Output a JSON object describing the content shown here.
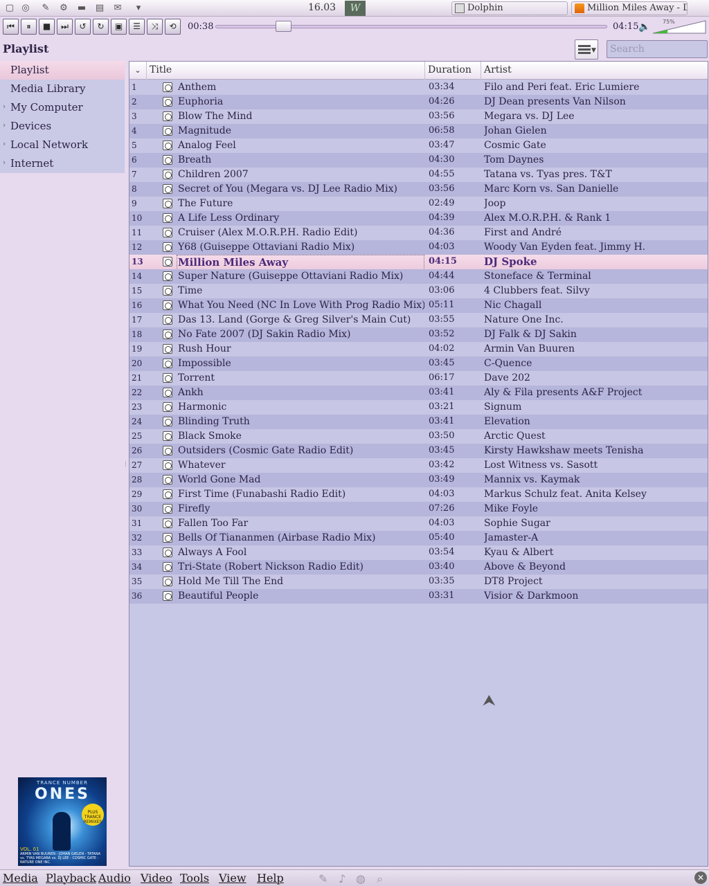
{
  "taskbar": {
    "clock": "16.03",
    "tasks": [
      {
        "label": "Dolphin"
      },
      {
        "label": "Million Miles Away - DJ"
      }
    ],
    "icons": [
      "app-icon",
      "network-icon",
      "edit-icon",
      "settings-icon",
      "disk-icon",
      "folder-icon",
      "mail-icon",
      "chevron-down-icon"
    ]
  },
  "player": {
    "elapsed": "00:38",
    "total": "04:15",
    "seek_fraction": 0.16,
    "volume_label": "75%",
    "volume_fraction": 0.75
  },
  "controls": [
    {
      "name": "previous-button",
      "icon": "skip-back-icon",
      "glyph": "⏮"
    },
    {
      "name": "pause-button",
      "icon": "pause-icon",
      "glyph": "⏸"
    },
    {
      "name": "stop-button",
      "icon": "stop-icon",
      "glyph": "■"
    },
    {
      "name": "next-button",
      "icon": "skip-forward-icon",
      "glyph": "⏭"
    },
    {
      "name": "slower-button",
      "icon": "rewind-loop-icon",
      "glyph": "↺"
    },
    {
      "name": "faster-button",
      "icon": "forward-loop-icon",
      "glyph": "↻"
    },
    {
      "name": "fullscreen-button",
      "icon": "fullscreen-icon",
      "glyph": "▣"
    },
    {
      "name": "playlist-toggle-button",
      "icon": "list-icon",
      "glyph": "☰"
    },
    {
      "name": "random-button",
      "icon": "shuffle-icon",
      "glyph": "⤨"
    },
    {
      "name": "loop-button",
      "icon": "repeat-icon",
      "glyph": "⟲"
    }
  ],
  "header": {
    "title": "Playlist",
    "search_placeholder": "Search"
  },
  "sidebar": {
    "items": [
      {
        "label": "Playlist",
        "arrow": ""
      },
      {
        "label": "Media Library",
        "arrow": ""
      },
      {
        "label": "My Computer",
        "arrow": "›"
      },
      {
        "label": "Devices",
        "arrow": "›"
      },
      {
        "label": "Local Network",
        "arrow": "›"
      },
      {
        "label": "Internet",
        "arrow": "›"
      }
    ]
  },
  "album_art": {
    "top_text": "TRANCE NUMBER",
    "logo": "ONES",
    "badge": "PLUS TRANCE REMIXES",
    "volume": "VOL. 01",
    "artists": "ARMIN VAN BUUREN - JOHAN GIELEN - TATANA vs. TYAS MEGARA vs. DJ LEE - COSMIC GATE - NATURE ONE INC."
  },
  "playlist": {
    "columns": {
      "sort": "⌄",
      "title": "Title",
      "duration": "Duration",
      "artist": "Artist"
    },
    "current_index": 13,
    "rows": [
      {
        "num": "1",
        "title": "Anthem",
        "duration": "03:34",
        "artist": "Filo and Peri feat. Eric Lumiere"
      },
      {
        "num": "2",
        "title": "Euphoria",
        "duration": "04:26",
        "artist": "DJ Dean presents Van Nilson"
      },
      {
        "num": "3",
        "title": "Blow The Mind",
        "duration": "03:56",
        "artist": "Megara vs. DJ Lee"
      },
      {
        "num": "4",
        "title": "Magnitude",
        "duration": "06:58",
        "artist": "Johan Gielen"
      },
      {
        "num": "5",
        "title": "Analog Feel",
        "duration": "03:47",
        "artist": "Cosmic Gate"
      },
      {
        "num": "6",
        "title": "Breath",
        "duration": "04:30",
        "artist": "Tom Daynes"
      },
      {
        "num": "7",
        "title": "Children 2007",
        "duration": "04:55",
        "artist": "Tatana vs. Tyas pres. T&T"
      },
      {
        "num": "8",
        "title": "Secret of You (Megara vs. DJ Lee Radio Mix)",
        "duration": "03:56",
        "artist": "Marc Korn vs. San Danielle"
      },
      {
        "num": "9",
        "title": "The Future",
        "duration": "02:49",
        "artist": "Joop"
      },
      {
        "num": "10",
        "title": "A Life Less Ordinary",
        "duration": "04:39",
        "artist": "Alex M.O.R.P.H. & Rank 1"
      },
      {
        "num": "11",
        "title": "Cruiser (Alex M.O.R.P.H. Radio Edit)",
        "duration": "04:36",
        "artist": "First and André"
      },
      {
        "num": "12",
        "title": "Y68 (Guiseppe Ottaviani Radio Mix)",
        "duration": "04:03",
        "artist": "Woody Van Eyden feat. Jimmy H."
      },
      {
        "num": "13",
        "title": "Million Miles Away",
        "duration": "04:15",
        "artist": "DJ Spoke"
      },
      {
        "num": "14",
        "title": "Super Nature (Guiseppe Ottaviani Radio Mix)",
        "duration": "04:44",
        "artist": "Stoneface & Terminal"
      },
      {
        "num": "15",
        "title": "Time",
        "duration": "03:06",
        "artist": "4 Clubbers feat. Silvy"
      },
      {
        "num": "16",
        "title": "What You Need (NC In Love With Prog Radio Mix)",
        "duration": "05:11",
        "artist": "Nic Chagall"
      },
      {
        "num": "17",
        "title": "Das 13. Land (Gorge & Greg Silver's Main Cut)",
        "duration": "03:55",
        "artist": "Nature One Inc."
      },
      {
        "num": "18",
        "title": "No Fate 2007 (DJ Sakin Radio Mix)",
        "duration": "03:52",
        "artist": "DJ Falk & DJ Sakin"
      },
      {
        "num": "19",
        "title": "Rush Hour",
        "duration": "04:02",
        "artist": "Armin Van Buuren"
      },
      {
        "num": "20",
        "title": "Impossible",
        "duration": "03:45",
        "artist": "C-Quence"
      },
      {
        "num": "21",
        "title": "Torrent",
        "duration": "06:17",
        "artist": "Dave 202"
      },
      {
        "num": "22",
        "title": "Ankh",
        "duration": "03:41",
        "artist": "Aly & Fila presents A&F Project"
      },
      {
        "num": "23",
        "title": "Harmonic",
        "duration": "03:21",
        "artist": "Signum"
      },
      {
        "num": "24",
        "title": "Blinding Truth",
        "duration": "03:41",
        "artist": "Elevation"
      },
      {
        "num": "25",
        "title": "Black Smoke",
        "duration": "03:50",
        "artist": "Arctic Quest"
      },
      {
        "num": "26",
        "title": "Outsiders (Cosmic Gate Radio Edit)",
        "duration": "03:45",
        "artist": "Kirsty Hawkshaw meets Tenisha"
      },
      {
        "num": "27",
        "title": "Whatever",
        "duration": "03:42",
        "artist": "Lost Witness vs. Sasott"
      },
      {
        "num": "28",
        "title": "World Gone Mad",
        "duration": "03:49",
        "artist": "Mannix vs. Kaymak"
      },
      {
        "num": "29",
        "title": "First Time (Funabashi Radio Edit)",
        "duration": "04:03",
        "artist": "Markus Schulz feat. Anita Kelsey"
      },
      {
        "num": "30",
        "title": "Firefly",
        "duration": "07:26",
        "artist": "Mike Foyle"
      },
      {
        "num": "31",
        "title": "Fallen Too Far",
        "duration": "04:03",
        "artist": "Sophie Sugar"
      },
      {
        "num": "32",
        "title": "Bells Of Tiananmen (Airbase Radio Mix)",
        "duration": "05:40",
        "artist": "Jamaster-A"
      },
      {
        "num": "33",
        "title": "Always A Fool",
        "duration": "03:54",
        "artist": "Kyau & Albert"
      },
      {
        "num": "34",
        "title": "Tri-State (Robert Nickson Radio Edit)",
        "duration": "03:40",
        "artist": "Above & Beyond"
      },
      {
        "num": "35",
        "title": "Hold Me Till The End",
        "duration": "03:35",
        "artist": "DT8 Project"
      },
      {
        "num": "36",
        "title": "Beautiful People",
        "duration": "03:31",
        "artist": "Visior & Darkmoon"
      }
    ]
  },
  "menubar": {
    "items": [
      "Media",
      "Playback",
      "Audio",
      "Video",
      "Tools",
      "View",
      "Help"
    ],
    "tray_icons": [
      "pen-icon",
      "music-note-icon",
      "globe-icon",
      "search-icon"
    ]
  },
  "colors": {
    "background": "#e7d9ee",
    "row_odd": "#c7c6e4",
    "row_even": "#b6b5db",
    "current_row": "#f3d6e6",
    "current_text": "#4b2a7a"
  }
}
